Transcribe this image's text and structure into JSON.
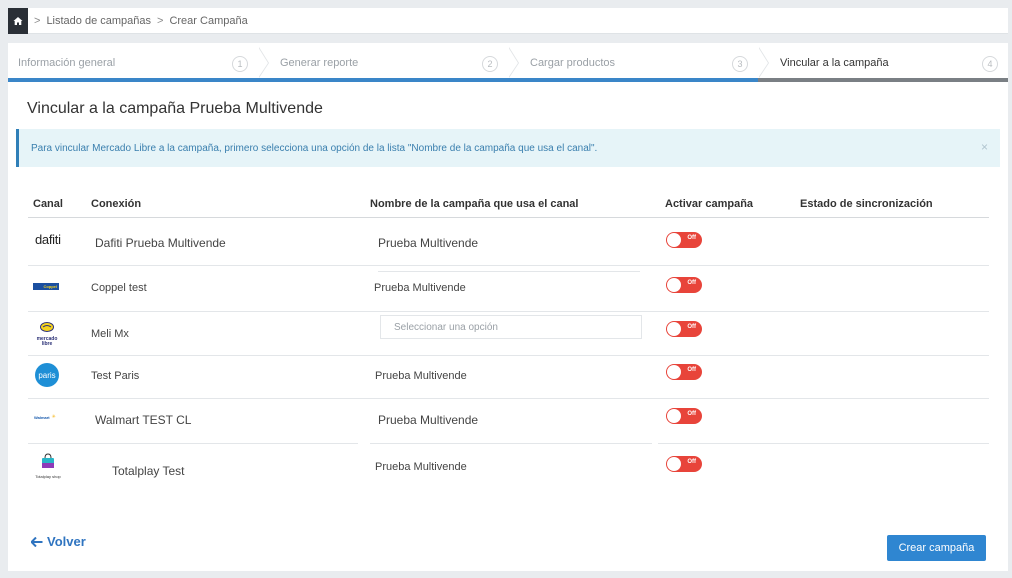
{
  "breadcrumb": {
    "items": [
      "Listado de campañas",
      "Crear Campaña"
    ],
    "separator": ">"
  },
  "stepper": {
    "steps": [
      {
        "label": "Información general",
        "num": "1"
      },
      {
        "label": "Generar reporte",
        "num": "2"
      },
      {
        "label": "Cargar productos",
        "num": "3"
      },
      {
        "label": "Vincular a la campaña",
        "num": "4"
      }
    ],
    "active_index": 3
  },
  "page": {
    "title": "Vincular a la campaña Prueba Multivende"
  },
  "alert": {
    "text": "Para vincular Mercado Libre a la campaña, primero selecciona una opción de la lista \"Nombre de la campaña que usa el canal\".",
    "close": "×"
  },
  "table": {
    "headers": {
      "canal": "Canal",
      "conexion": "Conexión",
      "nombre": "Nombre de la campaña que usa el canal",
      "activar": "Activar campaña",
      "estado": "Estado de sincronización"
    },
    "rows": [
      {
        "logo": "dafiti",
        "logo_name": "dafiti-logo",
        "conexion": "Dafiti Prueba Multivende",
        "campana": "Prueba Multivende",
        "toggle": "Off"
      },
      {
        "logo": "Coppel",
        "logo_name": "coppel-logo",
        "conexion": "Coppel test",
        "campana": "Prueba Multivende",
        "toggle": "Off"
      },
      {
        "logo": "mercado libre",
        "logo_name": "mercado-libre-logo",
        "conexion": "Meli Mx",
        "campana_placeholder": "Seleccionar una opción",
        "toggle": "Off"
      },
      {
        "logo": "paris",
        "logo_name": "paris-logo",
        "conexion": "Test Paris",
        "campana": "Prueba Multivende",
        "toggle": "Off"
      },
      {
        "logo": "Walmart",
        "logo_name": "walmart-logo",
        "conexion": "Walmart TEST CL",
        "campana": "Prueba Multivende",
        "toggle": "Off"
      },
      {
        "logo": "Totalplay shop",
        "logo_name": "totalplay-logo",
        "conexion": "Totalplay Test",
        "campana": "Prueba Multivende",
        "toggle": "Off"
      }
    ]
  },
  "footer": {
    "back_label": "Volver",
    "create_label": "Crear campaña"
  },
  "colors": {
    "accent": "#2f86d1",
    "toggle_off": "#e8443a",
    "alert_bg": "#e6f4f8",
    "home_bg": "#2a2f36"
  }
}
